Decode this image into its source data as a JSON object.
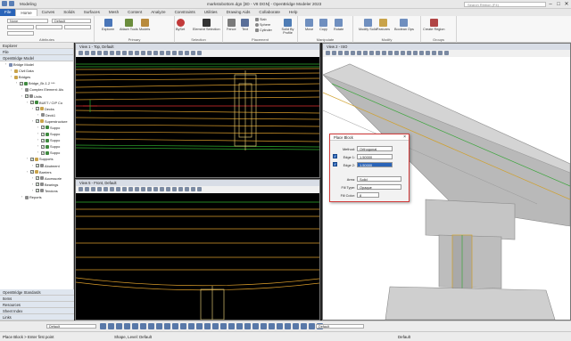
{
  "titlebar": {
    "workflow": "Modeling",
    "title": "markstobottom.dgn [3D - V8 DGN] - OpenBridge Modeler 2023",
    "search_placeholder": "Search Ribbon (F4)"
  },
  "tabs": [
    "File",
    "Home",
    "Curves",
    "Solids",
    "Surfaces",
    "Mesh",
    "Content",
    "Analyze",
    "Constraints",
    "Utilities",
    "Drawing Aids",
    "Collaborate",
    "Help"
  ],
  "ribbon": {
    "attributes": {
      "level": "None",
      "style": "Default",
      "label": "Attributes"
    },
    "primary": {
      "explorer": "Explorer",
      "attach_tools": "Attach Tools",
      "models": "Models",
      "label": "Primary"
    },
    "selection": {
      "bypass": "BySet",
      "element_selection": "Element Selection",
      "label": "Selection"
    },
    "placement": {
      "fence": "Fence",
      "place_text": "Text",
      "slab": "Slab",
      "sphere": "Sphere",
      "cylinder": "Cylinder",
      "solid_profile": "Solid By Profile",
      "label": "Placement"
    },
    "manipulate": {
      "move": "Move",
      "copy": "Copy",
      "rotate": "Rotate",
      "label": "Manipulate"
    },
    "modify": {
      "modify_solid": "Modify Solid",
      "features": "Features",
      "boolean": "Boolean Ops",
      "label": "Modify"
    },
    "groups": {
      "create_region": "Create Region",
      "label": "Groups"
    }
  },
  "explorer": {
    "title": "Explorer",
    "file_section": "File",
    "section": "OpenBridge Model",
    "tree": [
      {
        "label": "Bridge Model",
        "indent": 1,
        "color": "#7a8bb0"
      },
      {
        "label": "Civil Data",
        "indent": 2,
        "color": "#c9a34a"
      },
      {
        "label": "Bridges",
        "indent": 2,
        "color": "#c9a34a"
      },
      {
        "label": "Bridge_Br-1.2 ***",
        "indent": 3,
        "color": "#3f8a3f",
        "check": true
      },
      {
        "label": "Complex Element: Als",
        "indent": 4,
        "color": "#8a8a8a"
      },
      {
        "label": "Units",
        "indent": 4,
        "color": "#8a8a8a",
        "check": true
      },
      {
        "label": "BUET / CIP Co",
        "indent": 5,
        "color": "#3f8a3f",
        "check": true
      },
      {
        "label": "Decks",
        "indent": 6,
        "color": "#c9a34a",
        "check": true
      },
      {
        "label": "Deck1",
        "indent": 7,
        "color": "#8a8a8a"
      },
      {
        "label": "Superstructure",
        "indent": 6,
        "color": "#c9a34a",
        "check": true
      },
      {
        "label": "Suppo",
        "indent": 7,
        "color": "#3f8a3f",
        "check": true
      },
      {
        "label": "Suppo",
        "indent": 7,
        "color": "#3f8a3f",
        "check": true
      },
      {
        "label": "Suppo",
        "indent": 7,
        "color": "#3f8a3f",
        "check": true
      },
      {
        "label": "Suppo",
        "indent": 7,
        "color": "#3f8a3f",
        "check": true
      },
      {
        "label": "Suppo",
        "indent": 7,
        "color": "#3f8a3f",
        "check": true
      },
      {
        "label": "Supports",
        "indent": 5,
        "color": "#c9a34a",
        "check": true
      },
      {
        "label": "Abutment",
        "indent": 6,
        "color": "#8a8a8a",
        "check": true
      },
      {
        "label": "Barriers",
        "indent": 5,
        "color": "#c9a34a",
        "check": true
      },
      {
        "label": "Accessorie",
        "indent": 6,
        "color": "#8a8a8a",
        "check": true
      },
      {
        "label": "Bearings",
        "indent": 6,
        "color": "#8a8a8a",
        "check": true
      },
      {
        "label": "Tendons",
        "indent": 6,
        "color": "#8a8a8a",
        "check": true
      },
      {
        "label": "Reports",
        "indent": 4,
        "color": "#8a8a8a"
      }
    ],
    "bottom_sections": [
      "OpenBridge Standards",
      "Items",
      "Resources",
      "Sheet Index",
      "Links"
    ]
  },
  "views": {
    "view1": "View 1 - Top, Default",
    "view5": "View 5 - Front, Default",
    "view2": "View 2 - ISO"
  },
  "dialog": {
    "title": "Place Block",
    "method_label": "Method:",
    "method_value": "Orthogonal",
    "edge1_label": "Edge 1:",
    "edge1_value": "1.50000",
    "edge2_label": "Edge 2:",
    "edge2_value": "1.50000",
    "area_label": "Area:",
    "area_value": "Solid",
    "filltype_label": "Fill Type:",
    "filltype_value": "Opaque",
    "fillcolor_label": "Fill Color:",
    "fillcolor_value": "8"
  },
  "bottombar": {
    "view_combo": "Default",
    "view_combo2": "Default"
  },
  "status": {
    "prompt": "Place Block > Enter first point",
    "level": "Shape, Level: Default",
    "right": "Default"
  }
}
